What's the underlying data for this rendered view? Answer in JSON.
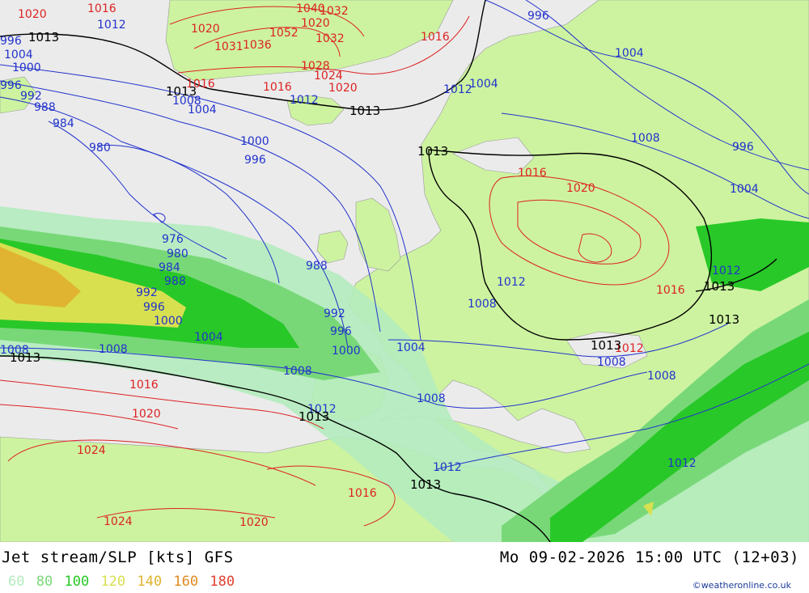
{
  "title": "Jet stream/SLP [kts] GFS",
  "datetime": "Mo 09-02-2026 15:00 UTC (12+03)",
  "legend": [
    {
      "value": "60",
      "color": "#b4ecbe"
    },
    {
      "value": "80",
      "color": "#78d878"
    },
    {
      "value": "100",
      "color": "#28c828"
    },
    {
      "value": "120",
      "color": "#d8e050"
    },
    {
      "value": "140",
      "color": "#e0b430"
    },
    {
      "value": "160",
      "color": "#e08a20"
    },
    {
      "value": "180",
      "color": "#e04030"
    }
  ],
  "credit": "©weatheronline.co.uk",
  "colors": {
    "sea": "#ebebeb",
    "land": "#cdf3a0",
    "isobar_low": "#2233cc",
    "isobar_high": "#dd2222",
    "isobar_1013": "#000000"
  },
  "map_labels": {
    "blue": [
      "1012",
      "1004",
      "1000",
      "996",
      "992",
      "988",
      "984",
      "980",
      "976",
      "980",
      "984",
      "988",
      "992",
      "996",
      "1000",
      "1004",
      "1008",
      "1008",
      "1000",
      "996",
      "1004",
      "1008",
      "1012",
      "1008",
      "1004",
      "1012",
      "996",
      "1004",
      "996",
      "1008",
      "1004",
      "1012",
      "1008",
      "1008",
      "1008",
      "1012",
      "1012",
      "1012",
      "1008",
      "1000",
      "996",
      "988",
      "992",
      "996",
      "1004",
      "1012"
    ],
    "red": [
      "1020",
      "1016",
      "1020",
      "1020",
      "1031",
      "1032",
      "1036",
      "1052",
      "1040",
      "1032",
      "1028",
      "1024",
      "1016",
      "1020",
      "1016",
      "1016",
      "1016",
      "1020",
      "1016",
      "1016",
      "1020",
      "1024",
      "1016",
      "1024",
      "1020",
      "1012"
    ],
    "black": [
      "1013",
      "1013",
      "1013",
      "1013",
      "1013",
      "1013",
      "1013",
      "1013",
      "1013",
      "1013"
    ]
  }
}
